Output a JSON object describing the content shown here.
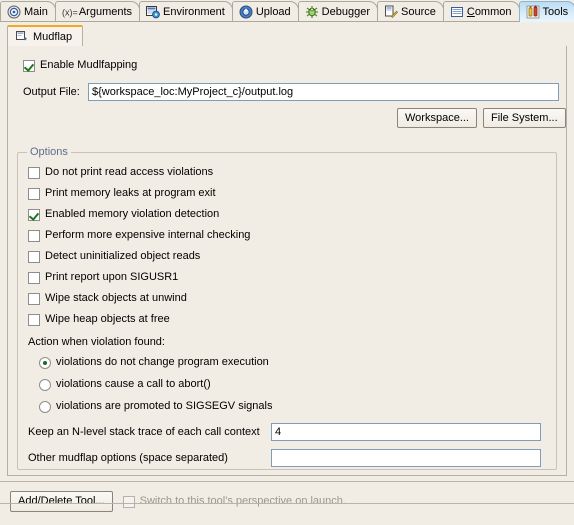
{
  "window": {
    "background": "#f2ede4",
    "accent_selected_tab": "#cde6f7",
    "accent_subtab_top": "#f5a623",
    "group_title_color": "#5a6f8c"
  },
  "top_tabs": [
    {
      "label": "Main",
      "icon": "target-icon",
      "selected": false,
      "underline": ""
    },
    {
      "label": "Arguments",
      "icon": "variable-icon",
      "selected": false,
      "underline": ""
    },
    {
      "label": "Environment",
      "icon": "environment-icon",
      "selected": false,
      "underline": ""
    },
    {
      "label": "Upload",
      "icon": "upload-icon",
      "selected": false,
      "underline": ""
    },
    {
      "label": "Debugger",
      "icon": "bug-icon",
      "selected": false,
      "underline": ""
    },
    {
      "label": "Source",
      "icon": "source-folder-icon",
      "selected": false,
      "underline": ""
    },
    {
      "label": "Common",
      "icon": "document-icon",
      "selected": false,
      "underline": "C"
    },
    {
      "label": "Tools",
      "icon": "tools-icon",
      "selected": true,
      "underline": ""
    }
  ],
  "sub_tabs": [
    {
      "label": "Mudflap",
      "icon": "mudflap-icon",
      "selected": true
    }
  ],
  "enable": {
    "label": "Enable Mudlfapping",
    "checked": true
  },
  "output_file": {
    "label": "Output File:",
    "value": "${workspace_loc:MyProject_c}/output.log",
    "placeholder": ""
  },
  "browse_buttons": [
    {
      "label": "Workspace..."
    },
    {
      "label": "File System..."
    }
  ],
  "options": {
    "title": "Options",
    "checkboxes": [
      {
        "label": "Do not print read access violations",
        "checked": false
      },
      {
        "label": "Print memory leaks at program exit",
        "checked": false
      },
      {
        "label": "Enabled memory violation detection",
        "checked": true
      },
      {
        "label": "Perform more expensive internal checking",
        "checked": false
      },
      {
        "label": "Detect uninitialized object reads",
        "checked": false
      },
      {
        "label": "Print report upon SIGUSR1",
        "checked": false
      },
      {
        "label": "Wipe stack objects at unwind",
        "checked": false
      },
      {
        "label": "Wipe heap objects at free",
        "checked": false
      }
    ],
    "action_label": "Action when violation found:",
    "radios": [
      {
        "label": "violations do not change program execution",
        "checked": true
      },
      {
        "label": "violations cause a call to abort()",
        "checked": false
      },
      {
        "label": "violations are promoted to SIGSEGV signals",
        "checked": false
      }
    ],
    "fields": [
      {
        "label": "Keep an N-level stack trace of each call context",
        "value": "4",
        "placeholder": ""
      },
      {
        "label": "Other mudflap options (space separated)",
        "value": "",
        "placeholder": ""
      }
    ]
  },
  "footer": {
    "add_delete_label": "Add/Delete Tool...",
    "switch_perspective_label": "Switch to this tool's perspective on launch.",
    "switch_perspective_checked": false,
    "switch_perspective_disabled": true
  }
}
